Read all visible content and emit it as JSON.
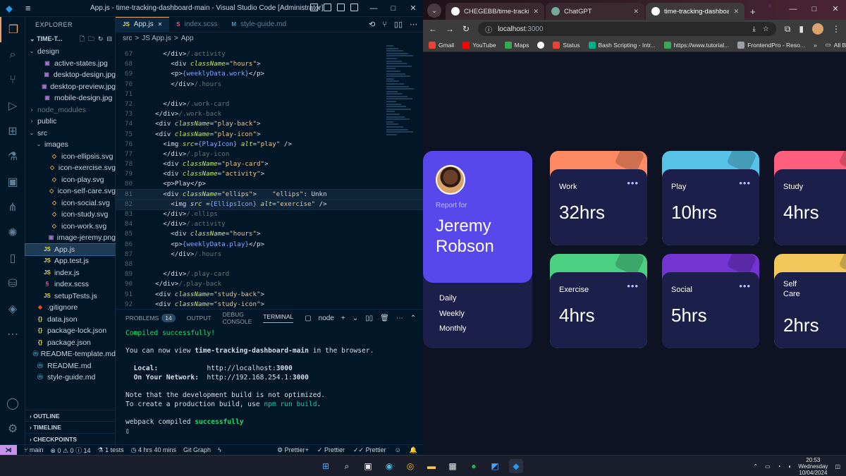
{
  "vscode": {
    "window_title": "App.js - time-tracking-dashboard-main - Visual Studio Code [Administrator]",
    "explorer": {
      "header": "EXPLORER",
      "project": "TIME-T...",
      "tree": [
        {
          "label": "design",
          "type": "folder-open",
          "depth": 0
        },
        {
          "label": "active-states.jpg",
          "type": "img",
          "depth": 1
        },
        {
          "label": "desktop-design.jpg",
          "type": "img",
          "depth": 1
        },
        {
          "label": "desktop-preview.jpg",
          "type": "img",
          "depth": 1
        },
        {
          "label": "mobile-design.jpg",
          "type": "img",
          "depth": 1
        },
        {
          "label": "node_modules",
          "type": "folder-closed",
          "depth": 0,
          "dim": true
        },
        {
          "label": "public",
          "type": "folder-closed",
          "depth": 0
        },
        {
          "label": "src",
          "type": "folder-open",
          "depth": 0
        },
        {
          "label": "images",
          "type": "folder-open",
          "depth": 1
        },
        {
          "label": "icon-ellipsis.svg",
          "type": "svg",
          "depth": 2
        },
        {
          "label": "icon-exercise.svg",
          "type": "svg",
          "depth": 2
        },
        {
          "label": "icon-play.svg",
          "type": "svg",
          "depth": 2
        },
        {
          "label": "icon-self-care.svg",
          "type": "svg",
          "depth": 2
        },
        {
          "label": "icon-social.svg",
          "type": "svg",
          "depth": 2
        },
        {
          "label": "icon-study.svg",
          "type": "svg",
          "depth": 2
        },
        {
          "label": "icon-work.svg",
          "type": "svg",
          "depth": 2
        },
        {
          "label": "image-jeremy.png",
          "type": "img",
          "depth": 2
        },
        {
          "label": "App.js",
          "type": "js",
          "depth": 1,
          "selected": true
        },
        {
          "label": "App.test.js",
          "type": "js",
          "depth": 1
        },
        {
          "label": "index.js",
          "type": "js",
          "depth": 1
        },
        {
          "label": "index.scss",
          "type": "scss",
          "depth": 1
        },
        {
          "label": "setupTests.js",
          "type": "js",
          "depth": 1
        },
        {
          "label": ".gitignore",
          "type": "git",
          "depth": 0
        },
        {
          "label": "data.json",
          "type": "json",
          "depth": 0
        },
        {
          "label": "package-lock.json",
          "type": "json",
          "depth": 0
        },
        {
          "label": "package.json",
          "type": "json",
          "depth": 0
        },
        {
          "label": "README-template.md",
          "type": "md",
          "depth": 0
        },
        {
          "label": "README.md",
          "type": "md",
          "depth": 0
        },
        {
          "label": "style-guide.md",
          "type": "md",
          "depth": 0
        }
      ],
      "sections": [
        "OUTLINE",
        "TIMELINE",
        "CHECKPOINTS"
      ]
    },
    "tabs": [
      {
        "label": "App.js",
        "icon": "JS",
        "active": true
      },
      {
        "label": "index.scss",
        "icon": "S",
        "active": false
      },
      {
        "label": "style-guide.md",
        "icon": "M",
        "active": false
      }
    ],
    "breadcrumbs": [
      "src",
      ">",
      "JS App.js",
      ">",
      "App"
    ],
    "code": [
      {
        "n": "67",
        "t": "      </div>/.activity"
      },
      {
        "n": "68",
        "t": "        <div className=\"hours\">"
      },
      {
        "n": "69",
        "t": "        <p>{weeklyData.work}</p>"
      },
      {
        "n": "70",
        "t": "        </div>/.hours"
      },
      {
        "n": "71",
        "t": ""
      },
      {
        "n": "72",
        "t": "      </div>/.work-card"
      },
      {
        "n": "73",
        "t": "    </div>/.work-back"
      },
      {
        "n": "74",
        "t": "    <div className=\"play-back\">"
      },
      {
        "n": "75",
        "t": "    <div className=\"play-icon\">"
      },
      {
        "n": "76",
        "t": "      <img src={PlayIcon} alt=\"play\" />"
      },
      {
        "n": "77",
        "t": "      </div>/.play-icon"
      },
      {
        "n": "78",
        "t": "      <div className=\"play-card\">"
      },
      {
        "n": "79",
        "t": "      <div className=\"activity\">"
      },
      {
        "n": "80",
        "t": "      <p>Play</p>"
      },
      {
        "n": "81",
        "t": "      <div className=\"ellips\">    \"ellips\": Unkn"
      },
      {
        "n": "82",
        "t": "        <img src ={EllipsIcon} alt=\"exercise\" />"
      },
      {
        "n": "83",
        "t": "      </div>/.ellips"
      },
      {
        "n": "84",
        "t": "      </div>/.activity"
      },
      {
        "n": "85",
        "t": "        <div className=\"hours\">"
      },
      {
        "n": "86",
        "t": "        <p>{weeklyData.play}</p>"
      },
      {
        "n": "87",
        "t": "        </div>/.hours"
      },
      {
        "n": "88",
        "t": ""
      },
      {
        "n": "89",
        "t": "      </div>/.play-card"
      },
      {
        "n": "90",
        "t": "    </div>/.play-back"
      },
      {
        "n": "91",
        "t": "    <div className=\"study-back\">"
      },
      {
        "n": "92",
        "t": "    <div className=\"study-icon\">"
      }
    ],
    "panel": {
      "tabs": [
        "PROBLEMS",
        "OUTPUT",
        "DEBUG CONSOLE",
        "TERMINAL"
      ],
      "problems_count": "14",
      "shell": "node",
      "terminal": [
        "Compiled successfully!",
        "",
        "You can now view time-tracking-dashboard-main in the browser.",
        "",
        "  Local:            http://localhost:3000",
        "  On Your Network:  http://192.168.254.1:3000",
        "",
        "Note that the development build is not optimized.",
        "To create a production build, use npm run build.",
        "",
        "webpack compiled successfully",
        "▯"
      ]
    },
    "statusbar": {
      "branch": "main",
      "problems": "⊗ 0 ⚠ 0 ⓘ 14",
      "tests": "1 tests",
      "time": "4 hrs 40 mins",
      "gitgraph": "Git Graph",
      "prettier_plus": "Prettier+",
      "prettier1": "Prettier",
      "prettier2": "Prettier"
    }
  },
  "chrome": {
    "tabs": [
      {
        "label": "CHEGEBB/time-tracking-dashb...",
        "color": "#ffffff"
      },
      {
        "label": "ChatGPT",
        "color": "#74aa9c"
      },
      {
        "label": "time-tracking-dashboard-main",
        "color": "#ffffff",
        "active": true
      }
    ],
    "url": "localhost",
    "port": ":3000",
    "bookmarks": [
      "Gmail",
      "YouTube",
      "Maps",
      "",
      "Status",
      "Bash Scripting - Intr...",
      "https://www.tutorial...",
      "FrontendPro - Reso..."
    ],
    "bookmarks_more": "»",
    "all_bookmarks": "All Bookmarks"
  },
  "dashboard": {
    "report_for": "Report for",
    "name": "Jeremy Robson",
    "periods": [
      "Daily",
      "Weekly",
      "Monthly"
    ],
    "cards": [
      {
        "name": "Work",
        "hours": "32hrs",
        "color": "#ff8b64"
      },
      {
        "name": "Play",
        "hours": "10hrs",
        "color": "#55c2e6"
      },
      {
        "name": "Study",
        "hours": "4hrs",
        "color": "#ff5e7d"
      },
      {
        "name": "Exercise",
        "hours": "4hrs",
        "color": "#4bcf82"
      },
      {
        "name": "Social",
        "hours": "5hrs",
        "color": "#7335d2"
      },
      {
        "name": "Self Care",
        "hours": "2hrs",
        "color": "#f1c75b"
      }
    ],
    "ellipsis": "•••"
  },
  "taskbar": {
    "time": "20:53",
    "day": "Wednesday",
    "date": "10/04/2024"
  }
}
